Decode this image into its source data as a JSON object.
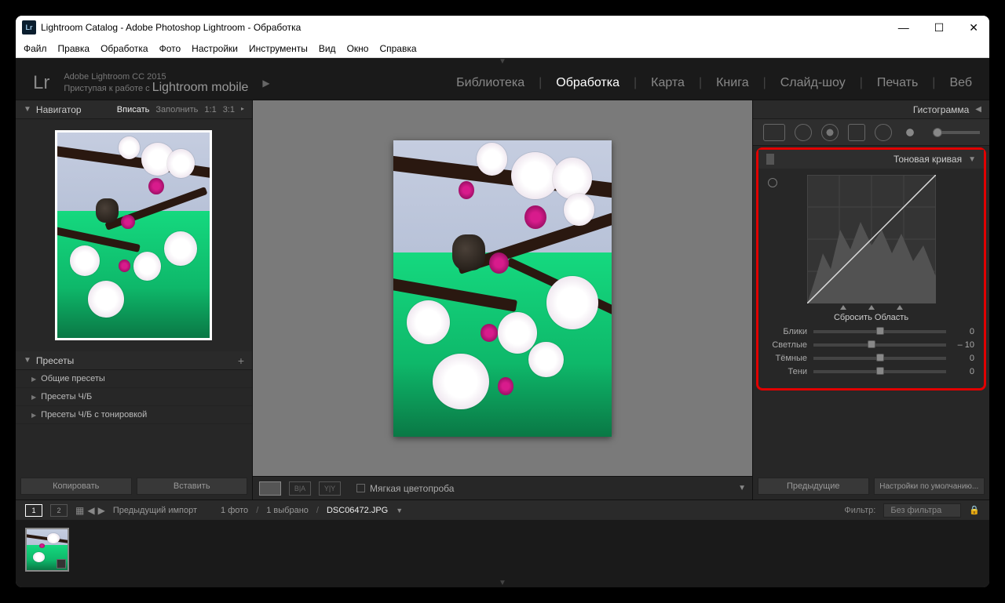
{
  "window": {
    "title": "Lightroom Catalog - Adobe Photoshop Lightroom - Обработка",
    "logo_text": "Lr"
  },
  "menu": [
    "Файл",
    "Правка",
    "Обработка",
    "Фото",
    "Настройки",
    "Инструменты",
    "Вид",
    "Окно",
    "Справка"
  ],
  "identity": {
    "line1": "Adobe Lightroom CC 2015",
    "line2_a": "Приступая к работе с ",
    "line2_b": "Lightroom mobile",
    "logo": "Lr"
  },
  "modules": {
    "items": [
      "Библиотека",
      "Обработка",
      "Карта",
      "Книга",
      "Слайд-шоу",
      "Печать",
      "Веб"
    ],
    "active": "Обработка"
  },
  "left": {
    "navigator_label": "Навигатор",
    "nav_opts": [
      "Вписать",
      "Заполнить",
      "1:1",
      "3:1"
    ],
    "nav_active": "Вписать",
    "presets_label": "Пресеты",
    "preset_groups": [
      "Общие пресеты",
      "Пресеты Ч/Б",
      "Пресеты Ч/Б с тонировкой"
    ],
    "copy_btn": "Копировать",
    "paste_btn": "Вставить"
  },
  "center": {
    "softproof_label": "Мягкая цветопроба"
  },
  "right": {
    "histogram_label": "Гистограмма",
    "tone_curve_label": "Тоновая кривая",
    "reset_region": "Сбросить Область",
    "sliders": [
      {
        "label": "Блики",
        "value": "0",
        "pos": 50
      },
      {
        "label": "Светлые",
        "value": "– 10",
        "pos": 44
      },
      {
        "label": "Тёмные",
        "value": "0",
        "pos": 50
      },
      {
        "label": "Тени",
        "value": "0",
        "pos": 50
      }
    ],
    "prev_btn": "Предыдущие",
    "default_btn": "Настройки по умолчанию..."
  },
  "filmstrip": {
    "prev_import": "Предыдущий импорт",
    "count": "1 фото",
    "selected": "1 выбрано",
    "filename": "DSC06472.JPG",
    "filter_label": "Фильтр:",
    "filter_value": "Без фильтра"
  }
}
